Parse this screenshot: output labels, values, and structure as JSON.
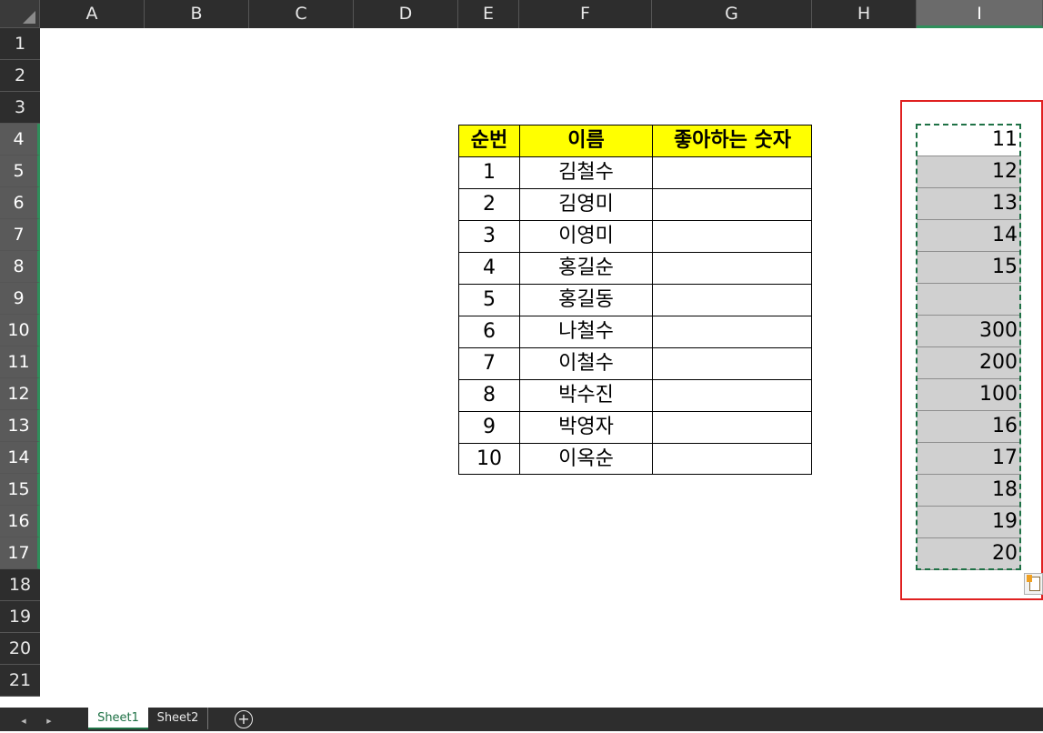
{
  "columns": [
    "A",
    "B",
    "C",
    "D",
    "E",
    "F",
    "G",
    "H",
    "I"
  ],
  "rows": [
    "1",
    "2",
    "3",
    "4",
    "5",
    "6",
    "7",
    "8",
    "9",
    "10",
    "11",
    "12",
    "13",
    "14",
    "15",
    "16",
    "17",
    "18",
    "19",
    "20",
    "21"
  ],
  "table": {
    "headers": [
      "순번",
      "이름",
      "좋아하는 숫자"
    ],
    "rows": [
      {
        "no": "1",
        "name": "김철수",
        "fav": ""
      },
      {
        "no": "2",
        "name": "김영미",
        "fav": ""
      },
      {
        "no": "3",
        "name": "이영미",
        "fav": ""
      },
      {
        "no": "4",
        "name": "홍길순",
        "fav": ""
      },
      {
        "no": "5",
        "name": "홍길동",
        "fav": ""
      },
      {
        "no": "6",
        "name": "나철수",
        "fav": ""
      },
      {
        "no": "7",
        "name": "이철수",
        "fav": ""
      },
      {
        "no": "8",
        "name": "박수진",
        "fav": ""
      },
      {
        "no": "9",
        "name": "박영자",
        "fav": ""
      },
      {
        "no": "10",
        "name": "이옥순",
        "fav": ""
      }
    ],
    "header_fill": "#ffff00"
  },
  "column_i_values": [
    "11",
    "12",
    "13",
    "14",
    "15",
    "",
    "300",
    "200",
    "100",
    "16",
    "17",
    "18",
    "19",
    "20"
  ],
  "selection": {
    "range": "I4:I17",
    "border_color": "#1e7145",
    "highlight_box_color": "#e02020"
  },
  "sheet_tabs": [
    {
      "label": "Sheet1",
      "active": true
    },
    {
      "label": "Sheet2",
      "active": false
    }
  ],
  "add_sheet_symbol": "+",
  "nav": {
    "prev": "◀",
    "next": "▶"
  }
}
